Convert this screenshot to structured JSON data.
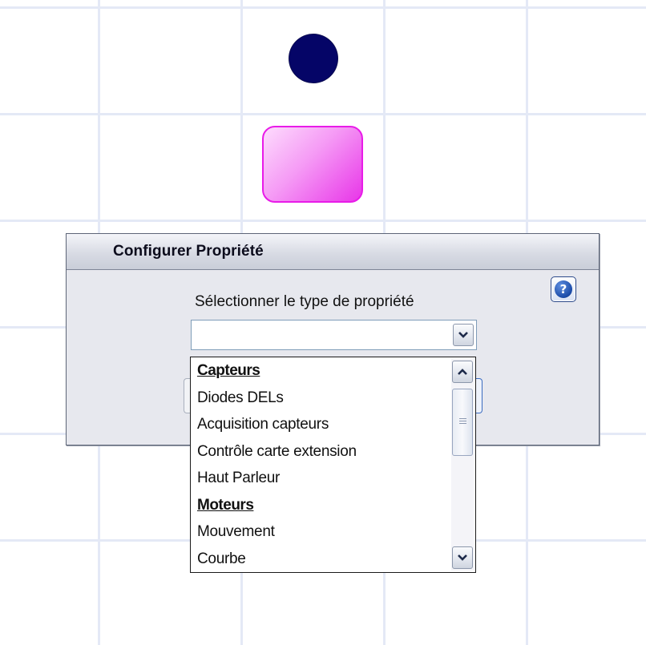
{
  "dialog": {
    "title": "Configurer Propriété",
    "prompt": "Sélectionner le type de propriété",
    "help_icon": "question-mark-icon",
    "combo": {
      "value": "",
      "expanded": true
    }
  },
  "dropdown": {
    "items": [
      {
        "label": "Capteurs",
        "kind": "category"
      },
      {
        "label": "Diodes DELs",
        "kind": "option"
      },
      {
        "label": "Acquisition capteurs",
        "kind": "option"
      },
      {
        "label": "Contrôle carte extension",
        "kind": "option"
      },
      {
        "label": "Haut Parleur",
        "kind": "option"
      },
      {
        "label": "Moteurs",
        "kind": "category"
      },
      {
        "label": "Mouvement",
        "kind": "option"
      },
      {
        "label": "Courbe",
        "kind": "option"
      }
    ]
  },
  "canvas": {
    "circle_color": "#050567",
    "rect_color": "#f59af5",
    "grid_color": "#e4e9f6"
  }
}
